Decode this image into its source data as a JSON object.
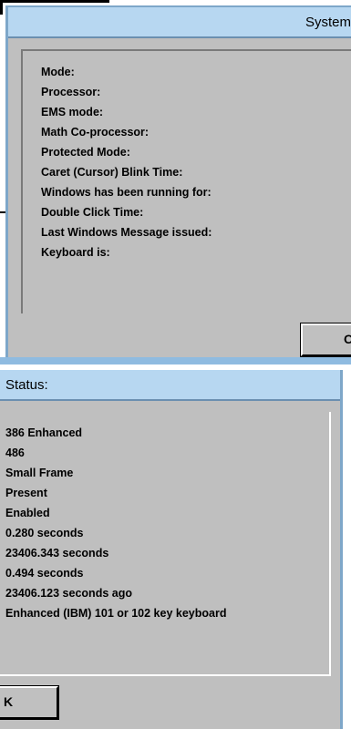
{
  "top_fragment": {
    "title": "System",
    "labels": [
      "Mode:",
      "Processor:",
      "EMS mode:",
      "Math Co-processor:",
      "Protected Mode:",
      "Caret (Cursor) Blink Time:",
      "Windows has been running for:",
      "Double Click Time:",
      "Last Windows Message issued:",
      "Keyboard is:"
    ],
    "ok_label": "O"
  },
  "bottom_fragment": {
    "title": "Status:",
    "values": [
      "386 Enhanced",
      "486",
      "Small Frame",
      "Present",
      "Enabled",
      "0.280 seconds",
      "23406.343 seconds",
      "0.494 seconds",
      "23406.123 seconds ago",
      "Enhanced (IBM) 101 or 102 key keyboard"
    ],
    "ok_label": "K"
  },
  "colors": {
    "titlebar": "#b7d7f1",
    "window_bg": "#bfbfbf",
    "frame_edge": "#7ea7c9"
  }
}
